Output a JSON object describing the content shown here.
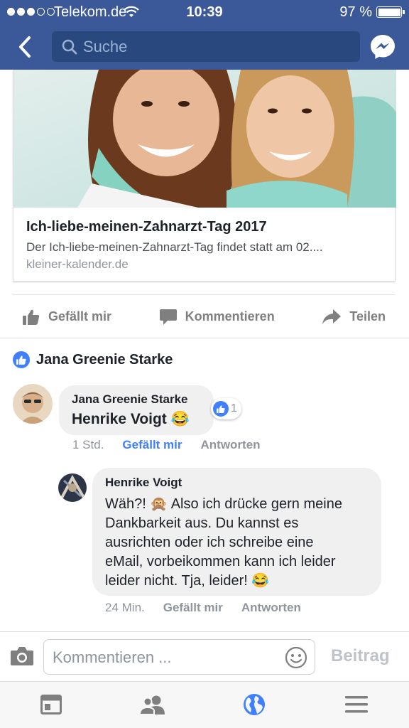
{
  "status_bar": {
    "carrier": "Telekom.de",
    "time": "10:39",
    "battery": "97 %"
  },
  "header": {
    "search_placeholder": "Suche"
  },
  "link_card": {
    "title": "Ich-liebe-meinen-Zahnarzt-Tag 2017",
    "description": "Der Ich-liebe-meinen-Zahnarzt-Tag findet statt am 02....",
    "domain": "kleiner-kalender.de"
  },
  "actions": {
    "like": "Gefällt mir",
    "comment": "Kommentieren",
    "share": "Teilen"
  },
  "reactions": {
    "reactor_name": "Jana Greenie Starke"
  },
  "comments": [
    {
      "author": "Jana Greenie Starke",
      "text": "Henrike Voigt",
      "emoji": "😂",
      "reaction_count": "1",
      "time": "1 Std.",
      "like_label": "Gefällt mir",
      "reply_label": "Antworten"
    },
    {
      "author": "Henrike Voigt",
      "text_lines": [
        "Wäh?! 🙊 Also ich drücke gern meine",
        "Dankbarkeit aus. Du kannst es",
        "ausrichten oder ich schreibe eine",
        "eMail, vorbeikommen kann ich leider",
        "leider nicht. Tja, leider! 😂"
      ],
      "time": "24 Min.",
      "like_label": "Gefällt mir",
      "reply_label": "Antworten"
    }
  ],
  "composer": {
    "placeholder": "Kommentieren ...",
    "post_label": "Beitrag"
  },
  "tabbar": {
    "icons": [
      "news-feed-icon",
      "friends-icon",
      "globe-icon",
      "menu-icon"
    ],
    "active": "globe-icon"
  },
  "colors": {
    "brand": "#3b5998",
    "link_blue": "#4080ff",
    "muted": "#90949c"
  }
}
